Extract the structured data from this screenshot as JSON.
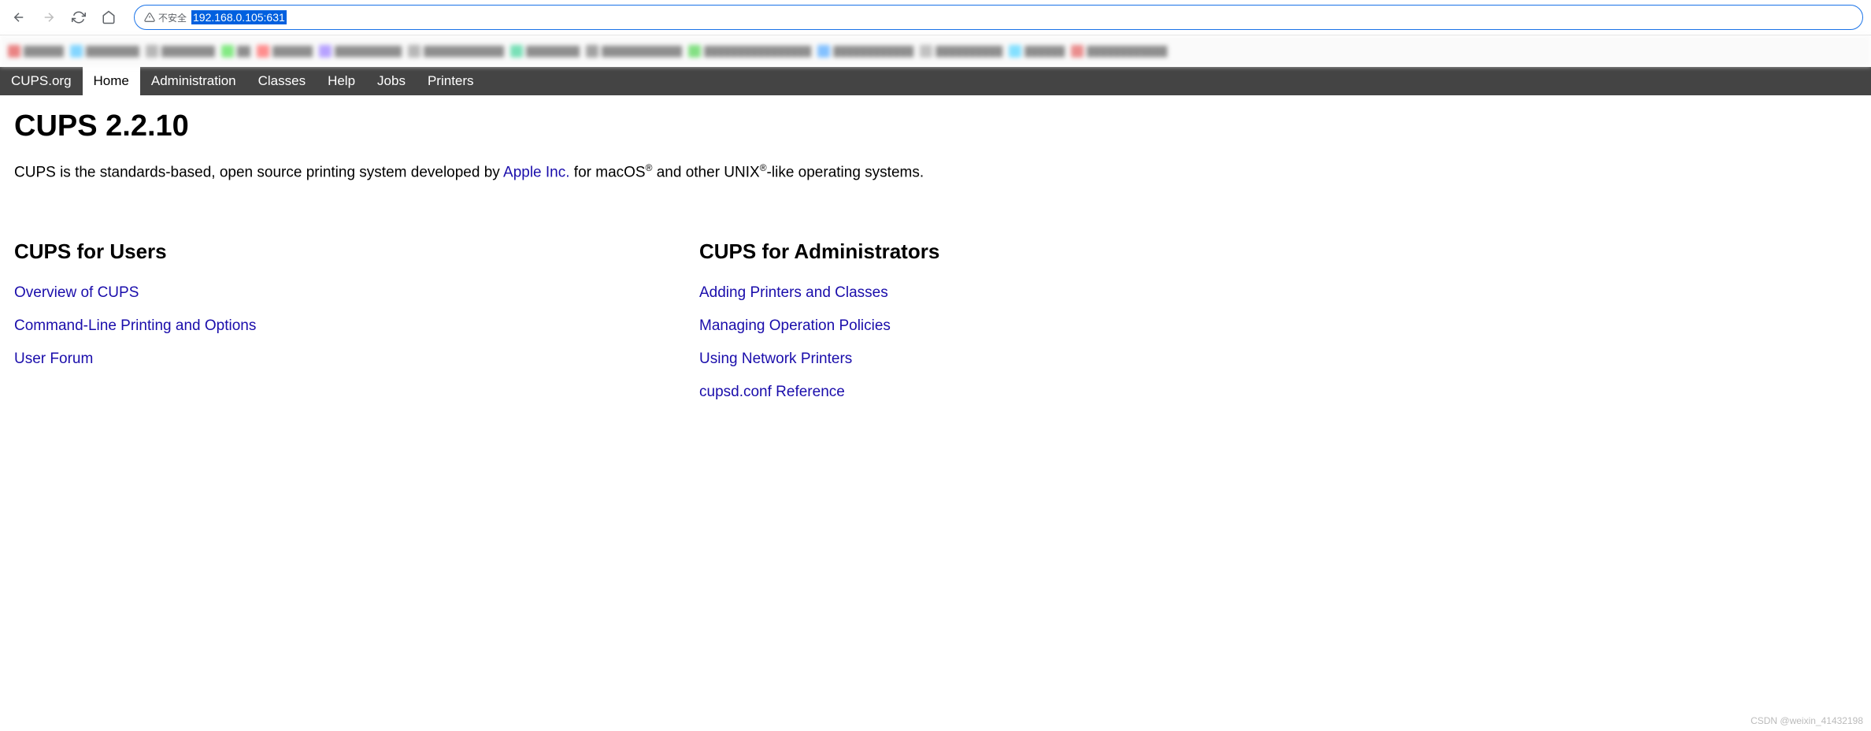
{
  "browser": {
    "not_secure_label": "不安全",
    "url_selected": "192.168.0.105:631"
  },
  "nav": {
    "items": [
      {
        "label": "CUPS.org",
        "active": false
      },
      {
        "label": "Home",
        "active": true
      },
      {
        "label": "Administration",
        "active": false
      },
      {
        "label": "Classes",
        "active": false
      },
      {
        "label": "Help",
        "active": false
      },
      {
        "label": "Jobs",
        "active": false
      },
      {
        "label": "Printers",
        "active": false
      }
    ]
  },
  "page": {
    "title": "CUPS 2.2.10",
    "intro_prefix": "CUPS is the standards-based, open source printing system developed by ",
    "apple_link": "Apple Inc.",
    "intro_mid": " for macOS",
    "intro_sup1": "®",
    "intro_mid2": " and other UNIX",
    "intro_sup2": "®",
    "intro_suffix": "-like operating systems."
  },
  "users": {
    "heading": "CUPS for Users",
    "links": [
      "Overview of CUPS",
      "Command-Line Printing and Options",
      "User Forum"
    ]
  },
  "admins": {
    "heading": "CUPS for Administrators",
    "links": [
      "Adding Printers and Classes",
      "Managing Operation Policies",
      "Using Network Printers",
      "cupsd.conf Reference"
    ]
  },
  "watermark": "CSDN @weixin_41432198"
}
